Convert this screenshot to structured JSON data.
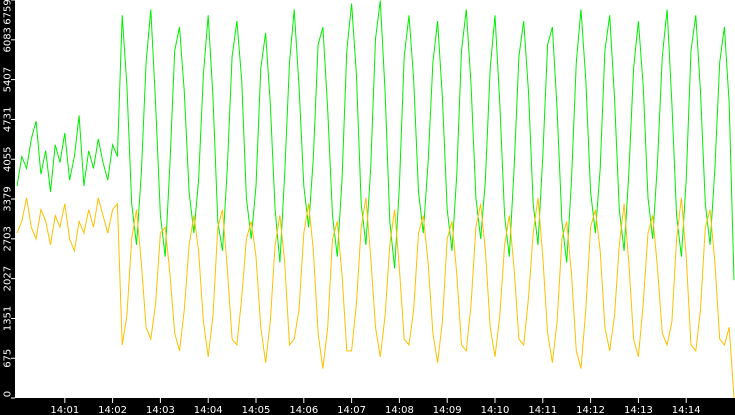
{
  "chart_data": {
    "type": "line",
    "title": "",
    "xlabel": "",
    "ylabel": "",
    "ylim": [
      0,
      6759
    ],
    "y_ticks": [
      "0",
      "675",
      "1351",
      "2027",
      "2703",
      "3379",
      "4055",
      "4731",
      "5407",
      "6083",
      "6759"
    ],
    "x_ticks": [
      "14:01",
      "14:02",
      "14:03",
      "14:04",
      "14:05",
      "14:06",
      "14:07",
      "14:08",
      "14:09",
      "14:10",
      "14:11",
      "14:12",
      "14:13",
      "14:14"
    ],
    "x_start": "14:00:00",
    "x_interval_seconds": 6,
    "series": [
      {
        "name": "green",
        "color": "#00ee00",
        "values": [
          3600,
          4100,
          3900,
          4400,
          4700,
          3800,
          4200,
          3500,
          4300,
          4000,
          4500,
          3700,
          4100,
          4800,
          3600,
          4200,
          3900,
          4400,
          4000,
          3700,
          4300,
          4100,
          6500,
          5300,
          3300,
          2600,
          3800,
          5700,
          6600,
          5000,
          3100,
          2400,
          4000,
          5900,
          6300,
          5200,
          3500,
          2800,
          3700,
          5500,
          6500,
          5100,
          3000,
          2500,
          3900,
          5800,
          6400,
          5400,
          3400,
          2700,
          3600,
          5600,
          6200,
          5000,
          3200,
          2300,
          3800,
          5700,
          6600,
          5300,
          3600,
          2900,
          4100,
          6000,
          6300,
          4900,
          3100,
          2400,
          3700,
          5900,
          6700,
          5500,
          3300,
          2600,
          3900,
          6100,
          6750,
          5200,
          3000,
          2200,
          3600,
          5800,
          6500,
          5400,
          3500,
          2800,
          4000,
          5700,
          6400,
          5100,
          3200,
          2500,
          3800,
          5900,
          6600,
          5300,
          3400,
          2700,
          3700,
          5600,
          6500,
          5000,
          3100,
          2400,
          3900,
          5800,
          6400,
          5200,
          3300,
          2600,
          4100,
          6000,
          6300,
          4900,
          3000,
          2300,
          3700,
          5700,
          6600,
          5400,
          3500,
          2800,
          3900,
          5900,
          6500,
          5100,
          3200,
          2500,
          3800,
          5600,
          6400,
          5300,
          3400,
          2700,
          4000,
          5800,
          6600,
          5000,
          3100,
          2400,
          3700,
          5900,
          6500,
          5200,
          3300,
          2600,
          3900,
          5700,
          6300,
          5000,
          2000
        ]
      },
      {
        "name": "orange",
        "color": "#ffc000",
        "values": [
          2800,
          3000,
          3400,
          2900,
          2700,
          3200,
          3000,
          2600,
          3100,
          2900,
          3300,
          2700,
          2500,
          3000,
          2800,
          3200,
          2900,
          3400,
          3100,
          2800,
          3200,
          3300,
          900,
          1400,
          2700,
          3200,
          2300,
          1200,
          1000,
          1600,
          2800,
          2900,
          2100,
          1100,
          800,
          1500,
          2600,
          3100,
          2500,
          1300,
          700,
          1400,
          2900,
          3200,
          2200,
          1000,
          900,
          1700,
          2700,
          3000,
          2400,
          1200,
          600,
          1300,
          2600,
          3100,
          2300,
          900,
          1000,
          1500,
          2800,
          3300,
          2500,
          1100,
          500,
          1200,
          2700,
          3000,
          2100,
          800,
          800,
          1600,
          2900,
          3400,
          2400,
          1200,
          700,
          1400,
          2600,
          3200,
          2200,
          1000,
          900,
          1500,
          2800,
          3100,
          2300,
          1100,
          600,
          1300,
          2700,
          3000,
          2100,
          900,
          800,
          1600,
          2900,
          3300,
          2500,
          1200,
          700,
          1400,
          2600,
          3100,
          2200,
          1000,
          900,
          1700,
          2800,
          3400,
          2400,
          1100,
          600,
          1300,
          2700,
          3000,
          2100,
          800,
          500,
          1500,
          2900,
          3200,
          2500,
          1200,
          800,
          1400,
          2600,
          3300,
          2300,
          1000,
          700,
          1600,
          2800,
          3100,
          2200,
          1100,
          900,
          1300,
          2700,
          3400,
          2400,
          900,
          800,
          1500,
          2900,
          3200,
          2300,
          1000,
          900,
          1200,
          0
        ]
      }
    ],
    "grid": false,
    "legend": "none"
  }
}
